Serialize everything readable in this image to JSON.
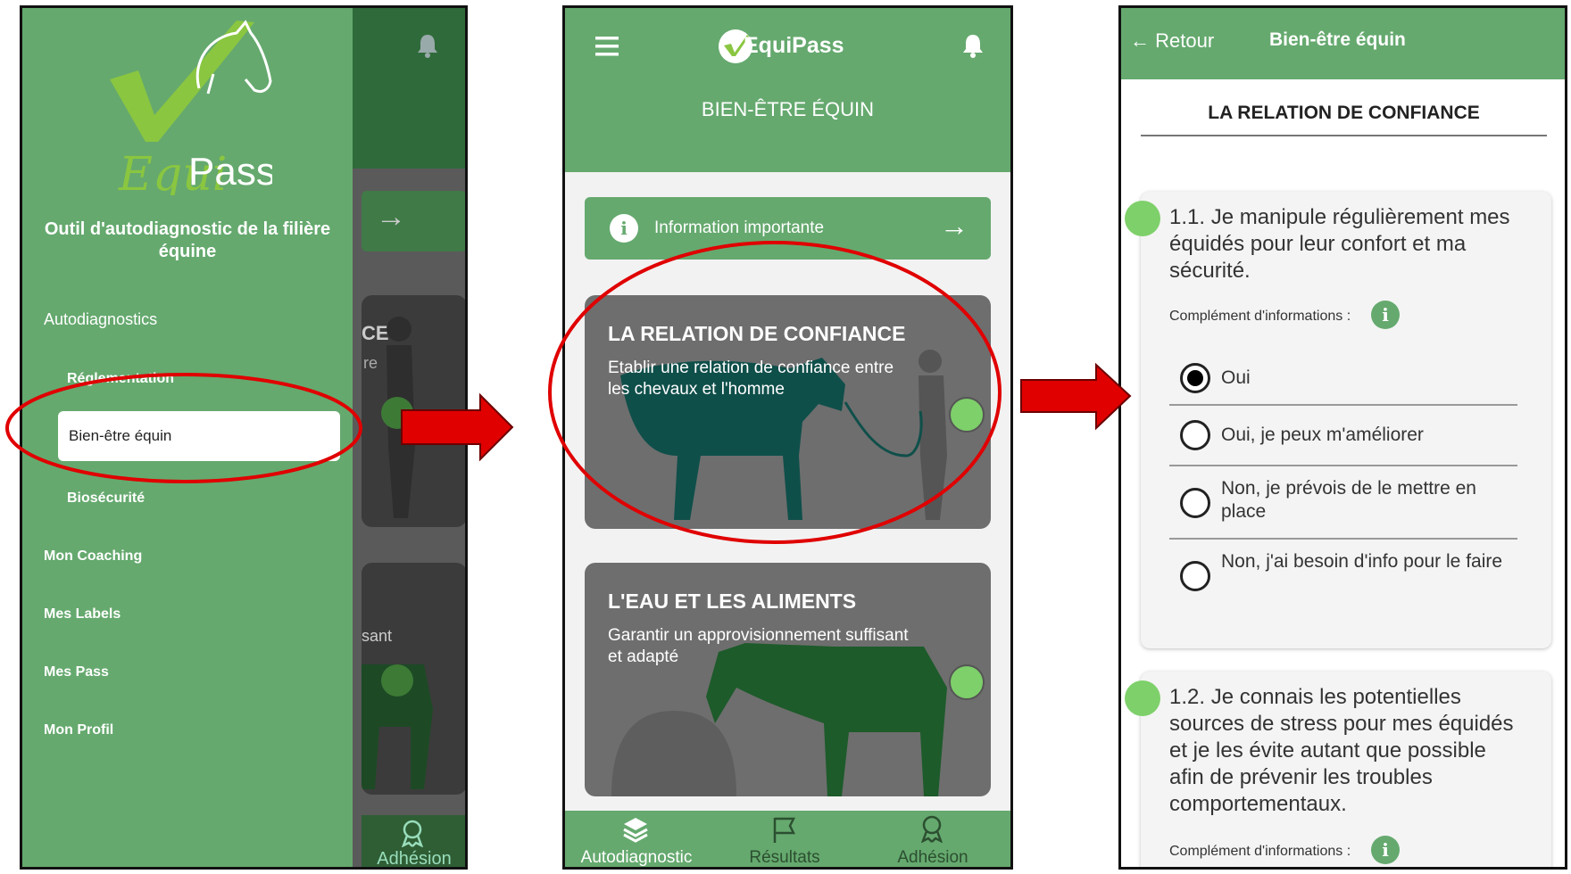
{
  "screen1": {
    "drawer": {
      "brand_script": "Equi",
      "brand_text": "Pass",
      "subtitle": "Outil d'autodiagnostic de la filière équine",
      "section": "Autodiagnostics",
      "subitems": [
        {
          "label": "Réglementation"
        },
        {
          "label": "Bien-être équin",
          "selected": true
        },
        {
          "label": "Biosécurité"
        }
      ],
      "menu": [
        {
          "label": "Mon Coaching"
        },
        {
          "label": "Mes Labels"
        },
        {
          "label": "Mes Pass"
        },
        {
          "label": "Mon Profil"
        }
      ]
    },
    "background": {
      "card1_fragment": "CE",
      "card1_fragment2": "re",
      "card2_fragment": "sant",
      "nav_label": "Adhésion"
    }
  },
  "screen2": {
    "header": {
      "app_name": "EquiPass",
      "page_title": "BIEN-ÊTRE ÉQUIN"
    },
    "info_bar": {
      "label": "Information importante"
    },
    "cards": [
      {
        "title": "LA RELATION DE CONFIANCE",
        "desc": "Etablir une relation de confiance entre les chevaux et l'homme",
        "status_color": "#7ed06a"
      },
      {
        "title": "L'EAU ET LES ALIMENTS",
        "desc": "Garantir un approvisionnement suffisant et adapté",
        "status_color": "#7ed06a"
      }
    ],
    "nav": [
      {
        "label": "Autodiagnostic",
        "icon": "layers-icon",
        "active": true
      },
      {
        "label": "Résultats",
        "icon": "flag-icon"
      },
      {
        "label": "Adhésion",
        "icon": "award-icon"
      }
    ]
  },
  "screen3": {
    "header": {
      "back_label": "Retour",
      "title": "Bien-être équin"
    },
    "section_title": "LA RELATION DE CONFIANCE",
    "questions": [
      {
        "text": "1.1. Je manipule régulièrement mes équidés pour leur confort et ma sécurité.",
        "complement_label": "Complément d'informations :",
        "options": [
          {
            "label": "Oui",
            "selected": true
          },
          {
            "label": "Oui, je peux m'améliorer"
          },
          {
            "label": "Non, je prévois de le mettre en place"
          },
          {
            "label": "Non, j'ai besoin d'info pour le faire"
          }
        ]
      },
      {
        "text": "1.2. Je connais les potentielles sources de stress pour mes équidés et je les évite autant que possible afin de prévenir les troubles comportementaux.",
        "complement_label": "Complément d'informations :"
      }
    ]
  },
  "colors": {
    "brand_green": "#65a96e",
    "status_green": "#7ed06a",
    "annotation_red": "#e00000",
    "card_gray": "#6e6e6e"
  }
}
